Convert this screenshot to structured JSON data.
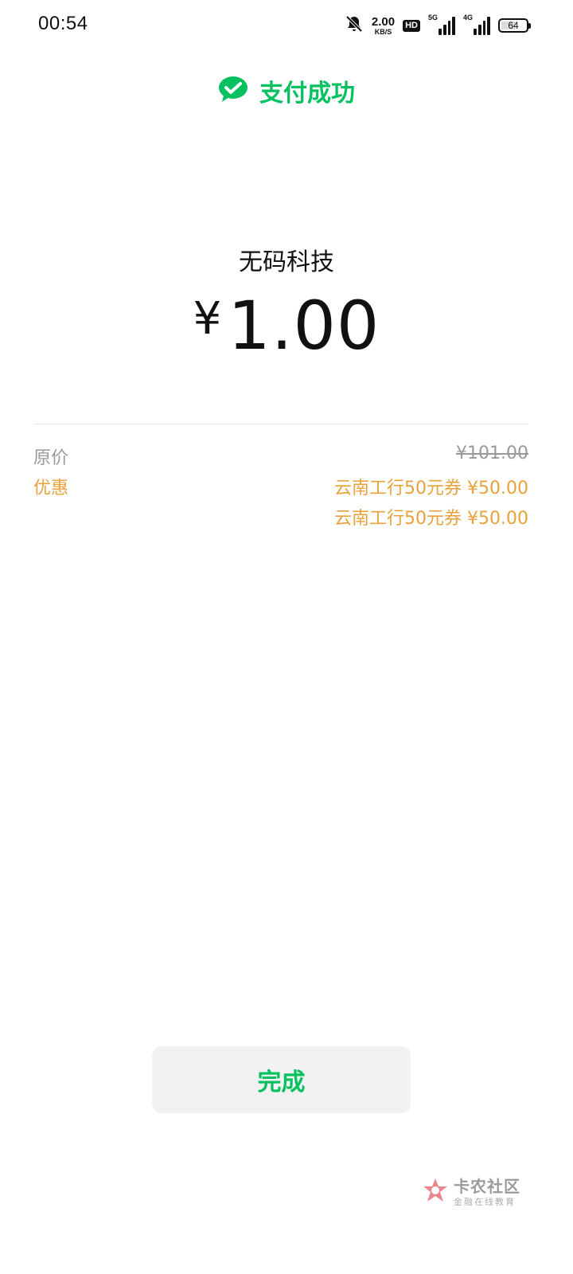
{
  "status_bar": {
    "time": "00:54",
    "net_speed_value": "2.00",
    "net_speed_unit": "KB/S",
    "hd_label": "HD",
    "sim1_label": "5G",
    "sim2_label": "4G",
    "battery_level": "64",
    "icons": [
      "bell-muted-icon",
      "hd-icon",
      "signal-icon",
      "signal-icon",
      "battery-icon"
    ]
  },
  "header": {
    "title": "支付成功",
    "icon": "wechat-pay-icon",
    "accent_color": "#07c160"
  },
  "payment": {
    "merchant": "无码科技",
    "currency_symbol": "¥",
    "amount": "1.00"
  },
  "details": {
    "original_label": "原价",
    "original_value": "¥101.00",
    "discount_label": "优惠",
    "discounts": [
      "云南工行50元券 ¥50.00",
      "云南工行50元券 ¥50.00"
    ],
    "discount_color": "#e8a23c"
  },
  "actions": {
    "done_label": "完成"
  },
  "watermark": {
    "main": "卡农社区",
    "sub": "金融在线教育"
  }
}
